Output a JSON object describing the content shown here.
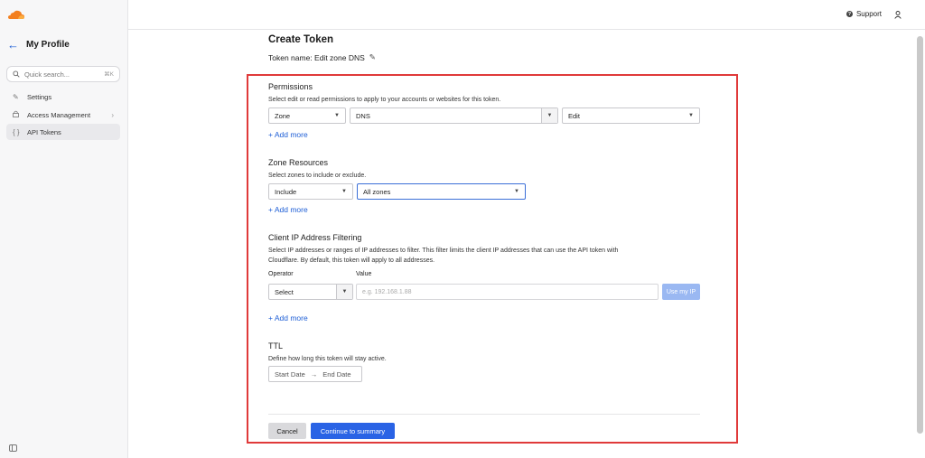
{
  "colors": {
    "accent": "#2a63e5",
    "link": "#1f5fd6",
    "highlight_border": "#e03a3a",
    "logo_orange": "#f38020"
  },
  "sidebar": {
    "back_icon": "arrow-left-icon",
    "title": "My Profile",
    "search": {
      "placeholder": "Quick search...",
      "shortcut": "⌘K"
    },
    "items": [
      {
        "label": "Settings",
        "icon": "pencil-icon",
        "active": false
      },
      {
        "label": "Access Management",
        "icon": "lock-icon",
        "active": false,
        "has_chevron": true
      },
      {
        "label": "API Tokens",
        "icon": "braces-icon",
        "active": true
      }
    ]
  },
  "topbar": {
    "support_label": "Support",
    "support_icon": "help-circle-icon",
    "user_icon": "user-icon"
  },
  "page": {
    "title": "Create Token",
    "token_name": "Token name: Edit zone DNS"
  },
  "permissions": {
    "title": "Permissions",
    "description": "Select edit or read permissions to apply to your accounts or websites for this token.",
    "scope": "Zone",
    "resource": "DNS",
    "access": "Edit",
    "add_more": "+ Add more"
  },
  "zone_resources": {
    "title": "Zone Resources",
    "description": "Select zones to include or exclude.",
    "mode": "Include",
    "zones": "All zones",
    "add_more": "+ Add more"
  },
  "ip_filtering": {
    "title": "Client IP Address Filtering",
    "description_line1": "Select IP addresses or ranges of IP addresses to filter. This filter limits the client IP addresses that can use the API token with",
    "description_line2": "Cloudflare. By default, this token will apply to all addresses.",
    "operator_label": "Operator",
    "value_label": "Value",
    "operator_value": "Select",
    "value_placeholder": "e.g. 192.168.1.88",
    "use_my_ip": "Use my IP",
    "add_more": "+ Add more"
  },
  "ttl": {
    "title": "TTL",
    "description": "Define how long this token will stay active.",
    "start": "Start Date",
    "arrow": "→",
    "end": "End Date"
  },
  "actions": {
    "cancel": "Cancel",
    "continue": "Continue to summary"
  }
}
